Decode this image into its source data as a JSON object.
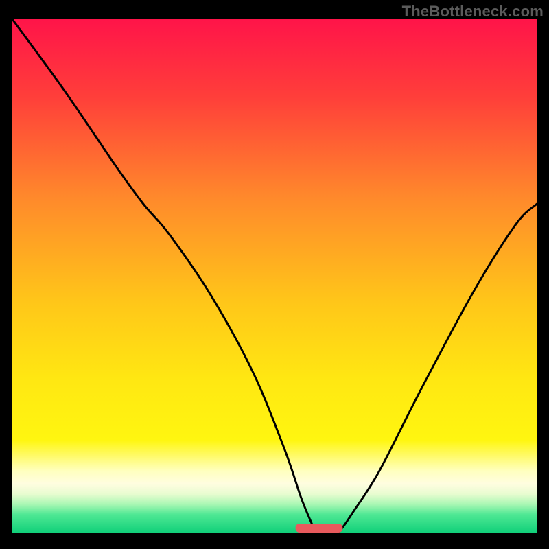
{
  "watermark": "TheBottleneck.com",
  "colors": {
    "background": "#000000",
    "curve": "#000000",
    "gradient_stops": [
      {
        "offset": 0.0,
        "color": "#ff1449"
      },
      {
        "offset": 0.15,
        "color": "#ff3e3a"
      },
      {
        "offset": 0.35,
        "color": "#ff8a2b"
      },
      {
        "offset": 0.55,
        "color": "#ffc619"
      },
      {
        "offset": 0.7,
        "color": "#ffe712"
      },
      {
        "offset": 0.82,
        "color": "#fff610"
      },
      {
        "offset": 0.88,
        "color": "#ffffbf"
      },
      {
        "offset": 0.905,
        "color": "#fffde0"
      },
      {
        "offset": 0.925,
        "color": "#e8fcd0"
      },
      {
        "offset": 0.945,
        "color": "#a9f7b3"
      },
      {
        "offset": 0.965,
        "color": "#4fe894"
      },
      {
        "offset": 1.0,
        "color": "#11d07a"
      }
    ],
    "marker": "#e85a5d"
  },
  "chart_data": {
    "type": "line",
    "title": "",
    "xlabel": "",
    "ylabel": "",
    "xlim": [
      0,
      100
    ],
    "ylim": [
      0,
      100
    ],
    "grid": false,
    "background": "vertical-gradient",
    "annotations": [
      {
        "kind": "watermark",
        "text": "TheBottleneck.com",
        "position": "top-right"
      },
      {
        "kind": "marker",
        "shape": "rounded-bar",
        "x_range": [
          54,
          63
        ],
        "y": 0,
        "color": "#e85a5d"
      }
    ],
    "series": [
      {
        "name": "bottleneck-curve",
        "x": [
          0,
          10,
          20,
          25,
          30,
          38,
          46,
          52,
          55,
          57,
          58,
          60,
          62,
          63,
          65,
          70,
          78,
          88,
          96,
          100
        ],
        "values": [
          100,
          86,
          71,
          64,
          58,
          46,
          31,
          16,
          7,
          2,
          0,
          0,
          0,
          1,
          4,
          12,
          28,
          47,
          60,
          64
        ]
      }
    ],
    "optimum_x": 59
  }
}
